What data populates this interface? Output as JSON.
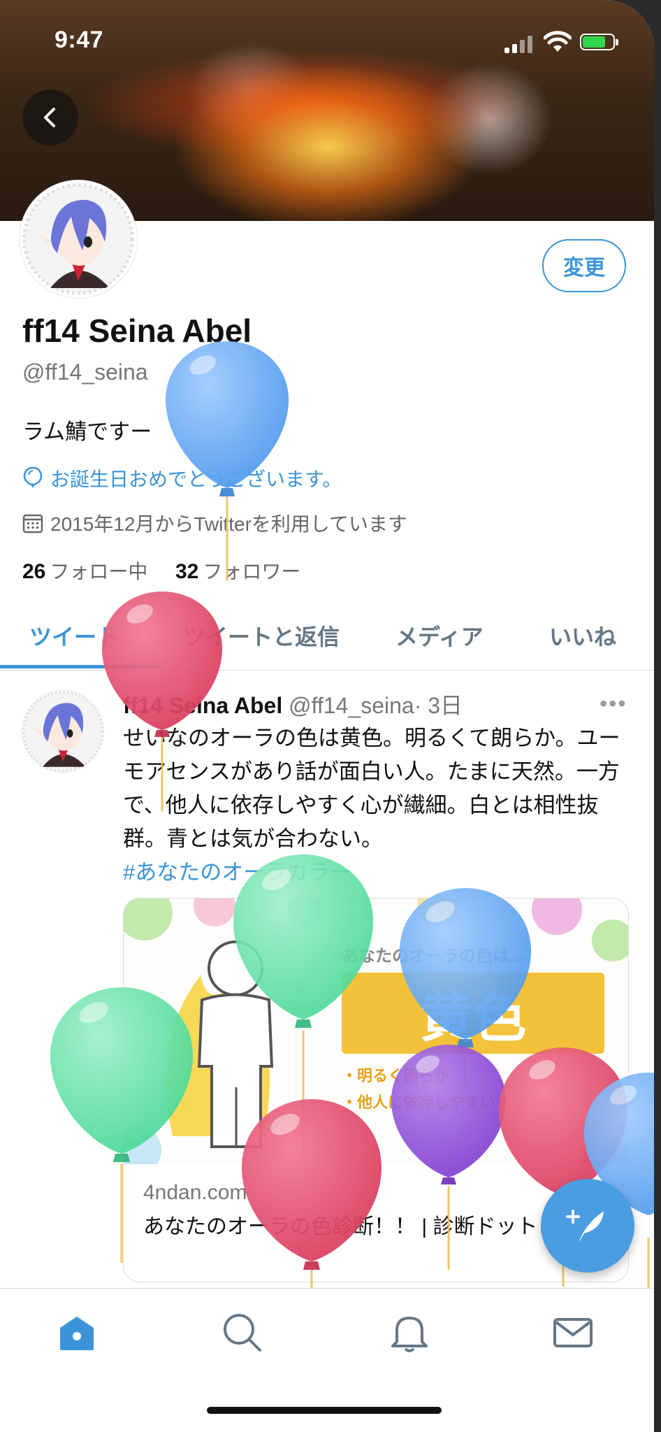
{
  "status_bar": {
    "time": "9:47"
  },
  "profile": {
    "edit_label": "変更",
    "name": "ff14 Seina Abel",
    "handle": "@ff14_seina",
    "bio": "ラム鯖ですー",
    "birthday_text": "お誕生日おめでとうございます。",
    "joined_text": "2015年12月からTwitterを利用しています",
    "following_count": "26",
    "following_label": "フォロー中",
    "followers_count": "32",
    "followers_label": "フォロワー"
  },
  "tabs": [
    {
      "label": "ツイート"
    },
    {
      "label": "ツイートと返信"
    },
    {
      "label": "メディア"
    },
    {
      "label": "いいね"
    }
  ],
  "tweet": {
    "name": "ff14 Seina Abel",
    "handle": "@ff14_seina",
    "time": "· 3日",
    "more": "•••",
    "text": "せいなのオーラの色は黄色。明るくて朗らか。ユーモアセンスがあり話が面白い人。たまに天然。一方で、他人に依存しやすく心が繊細。白とは相性抜群。青とは気が合わない。",
    "hashtag": "#あなたのオーラカラー",
    "card": {
      "image_heading": "あなたのオーラの色は…",
      "image_color": "黄色",
      "image_point1": "・明るく朗らか",
      "image_point2": "・他人に依存しやすい",
      "domain": "4ndan.com",
      "title": "あなたのオーラの色診断！！ | 診断ドットコム"
    }
  },
  "icons": {
    "back": "chevron-left-icon",
    "location": "balloon-pin-icon",
    "calendar": "calendar-icon",
    "compose": "compose-quill-icon",
    "home": "home-icon",
    "search": "search-icon",
    "notifications": "bell-icon",
    "messages": "mail-icon"
  },
  "colors": {
    "accent": "#3b94d9",
    "balloon_blue": "#5ea8f0",
    "balloon_red": "#e24a6a",
    "balloon_green": "#5fe0a6",
    "balloon_purple": "#8a4ad6",
    "card_yellow": "#f3c23a"
  }
}
